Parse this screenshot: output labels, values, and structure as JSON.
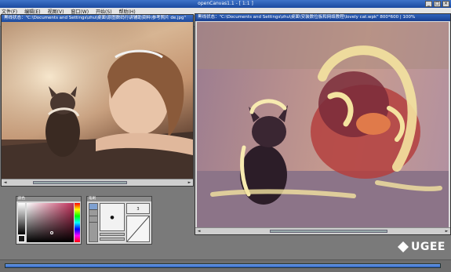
{
  "app": {
    "title": "openCanvas1.1 - [ 1:1 ]",
    "window_buttons": [
      "_",
      "□",
      "×"
    ]
  },
  "menu": {
    "items": [
      "文件(F)",
      "编辑(E)",
      "视图(V)",
      "窗口(W)",
      "开始(S)",
      "帮助(H)"
    ]
  },
  "left_window": {
    "title": "黑线状态：\"C:\\Documents and Settings\\zhu\\桌面\\原图数码行讲辅助资料\\参考照片 de.jpg\"",
    "scroll_arrows": [
      "◄",
      "►"
    ]
  },
  "right_window": {
    "title": "黑线状态：\"C:\\Documents and Settings\\zhu\\桌面\\安装数位板和网络教程\\lovely cat.wpk\" 800*600 | 100%",
    "scroll_arrows": [
      "◄",
      "►"
    ]
  },
  "color_panel": {
    "title": "颜色",
    "colors": {
      "primary": "#1a1a1a",
      "secondary": "#ffffff",
      "hue_selected": "#c0305a"
    }
  },
  "brush_panel": {
    "title": "笔刷",
    "size_label": "●",
    "value": "3"
  },
  "brand": {
    "logo_text": "UGEE"
  },
  "status": {
    "progress": 1.0
  },
  "colors": {
    "titlebar": "#2a5db5",
    "background": "#7a7a7a",
    "accent": "#3e6fc4"
  }
}
